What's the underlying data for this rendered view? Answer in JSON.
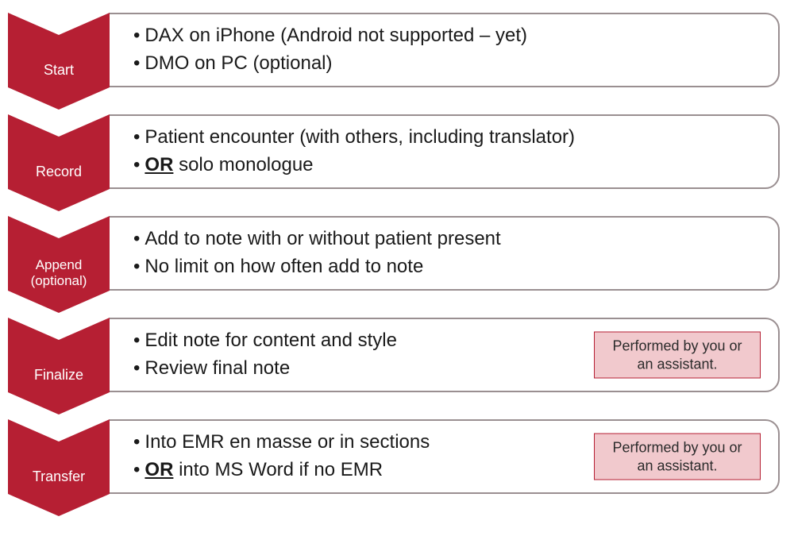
{
  "steps": [
    {
      "label": "Start",
      "items": [
        {
          "text": "DAX on iPhone (Android not supported – yet)"
        },
        {
          "text": "DMO on PC (optional)"
        }
      ]
    },
    {
      "label": "Record",
      "items": [
        {
          "text": "Patient encounter (with others, including translator)"
        },
        {
          "prefix": "OR",
          "text": " solo monologue"
        }
      ]
    },
    {
      "label": "Append (optional)",
      "small": true,
      "items": [
        {
          "text": "Add to note with or without patient present"
        },
        {
          "text": "No limit on how often add to note"
        }
      ]
    },
    {
      "label": "Finalize",
      "items": [
        {
          "text": "Edit note for content and style"
        },
        {
          "text": "Review final note"
        }
      ],
      "note": "Performed by you or an assistant."
    },
    {
      "label": "Transfer",
      "items": [
        {
          "text": "Into EMR en masse or in sections"
        },
        {
          "prefix": "OR",
          "text": " into MS Word if no EMR"
        }
      ],
      "note": "Performed by you or an assistant."
    }
  ],
  "colors": {
    "accent": "#b61f33",
    "note_bg": "#f1c9cd"
  }
}
